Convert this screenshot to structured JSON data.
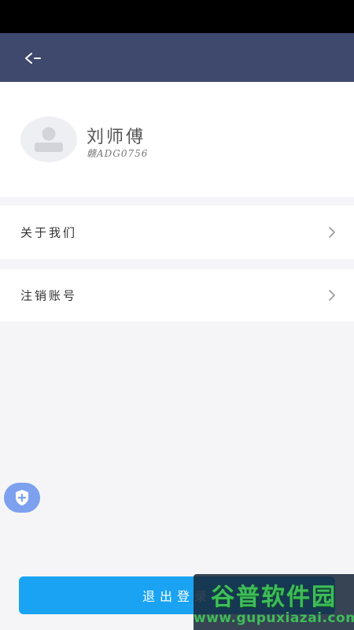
{
  "header": {
    "back_icon": "back-arrow-icon"
  },
  "profile": {
    "avatar_icon": "user-avatar-icon",
    "name": "刘师傅",
    "plate": "赣ADG0756"
  },
  "menu": [
    {
      "label": "关于我们",
      "icon": "chevron-right-icon"
    },
    {
      "label": "注销账号",
      "icon": "chevron-right-icon"
    }
  ],
  "floating": {
    "icon": "shield-plus-icon"
  },
  "logout": {
    "label": "退出登录"
  },
  "watermark": {
    "title": "谷普软件园",
    "url": "www.gupuxiazai.com"
  },
  "colors": {
    "nav": "#3f486d",
    "accent": "#1aa3f2",
    "background": "#f5f5f7",
    "watermark_green": "#3fbc5a"
  }
}
